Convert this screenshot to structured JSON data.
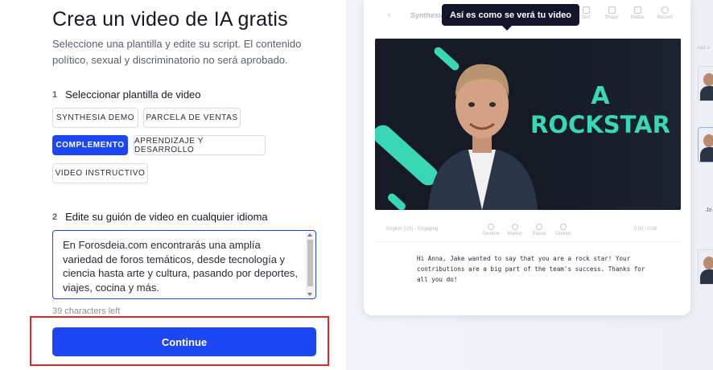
{
  "page": {
    "title": "Crea un video de IA gratis",
    "subtitle": "Seleccione una plantilla y edite su script. El contenido político, sexual y discriminatorio no será aprobado."
  },
  "step1": {
    "number": "1",
    "label": "Seleccionar plantilla de video",
    "templates": [
      {
        "label": "SYNTHESIA DEMO",
        "selected": false
      },
      {
        "label": "PARCELA DE VENTAS",
        "selected": false
      },
      {
        "label": "COMPLEMENTO",
        "selected": true
      },
      {
        "label": "APRENDIZAJE Y DESARROLLO",
        "selected": false
      },
      {
        "label": "VIDEO INSTRUCTIVO",
        "selected": false
      }
    ]
  },
  "step2": {
    "number": "2",
    "label": "Edite su guión de video en cualquier idioma",
    "script_value": "En Forosdeia.com encontrarás una amplía variedad de foros temáticos, desde tecnología y ciencia hasta arte y cultura, pasando por deportes, viajes, cocina y más.",
    "chars_left": "39 characters left"
  },
  "continue_label": "Continue",
  "preview": {
    "tooltip": "Así es como se verá tu video",
    "toolbar_title": "Synthesia",
    "toolbar_items": [
      "Text",
      "Shape",
      "Media",
      "Record"
    ],
    "video_text_line1": "A",
    "video_text_line2": "ROCKSTAR",
    "editor": {
      "voice": "English (US) - Engaging",
      "tools": [
        "Gesture",
        "Marker",
        "Pause",
        "Diction"
      ],
      "time": "0:00 / 0:09",
      "script": "Hi Anna, Jake wanted to say that you are a rock star! Your contributions are a big part of the team's success. Thanks for all you do!"
    },
    "side": {
      "label": "Add a",
      "avatar_name": "Jo"
    }
  },
  "colors": {
    "accent": "#1c47f2",
    "highlight": "#e0262b",
    "video_teal": "#3ad7b6",
    "tooltip_bg": "#14152a"
  }
}
